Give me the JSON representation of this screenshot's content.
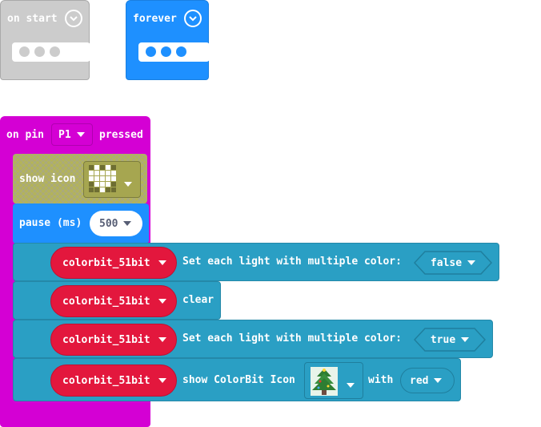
{
  "on_start": {
    "label": "on start"
  },
  "forever": {
    "label": "forever"
  },
  "on_pin": {
    "prefix": "on pin",
    "pin_value": "P1",
    "suffix": "pressed"
  },
  "show_icon": {
    "label": "show icon",
    "icon_name": "heart-icon"
  },
  "pause": {
    "label": "pause (ms)",
    "value": "500"
  },
  "colorbit_rows": [
    {
      "device": "colorbit_51bit",
      "action": "Set each light with multiple color:",
      "value": "false"
    },
    {
      "device": "colorbit_51bit",
      "action": "clear"
    },
    {
      "device": "colorbit_51bit",
      "action": "Set each light with multiple color:",
      "value": "true"
    },
    {
      "device": "colorbit_51bit",
      "action": "show ColorBit Icon",
      "icon_name": "christmas-tree-icon",
      "with_label": "with",
      "color_value": "red"
    }
  ],
  "colors": {
    "event_magenta": "#d400d4",
    "event_blue": "#1e90ff",
    "event_gray": "#cccccc",
    "basic_olive": "#b3b35b",
    "colorbit_teal": "#2a9fc4",
    "colorbit_red": "#e3173d"
  }
}
